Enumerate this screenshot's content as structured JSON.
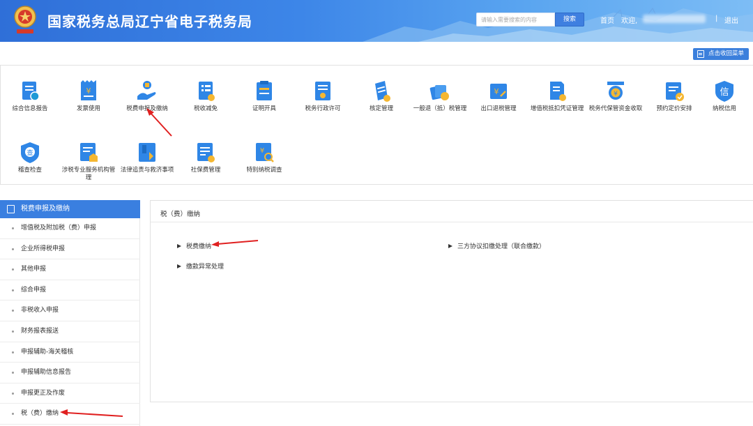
{
  "header": {
    "title": "国家税务总局辽宁省电子税务局",
    "search_placeholder": "请输入需要搜索的内容",
    "search_button": "搜索",
    "home": "首页",
    "welcome": "欢迎,",
    "separator": "|",
    "logout": "退出"
  },
  "collapse_button": "点击收回菜单",
  "menu": {
    "items": [
      {
        "label": "综合信息报告",
        "icon": "report-icon"
      },
      {
        "label": "发票使用",
        "icon": "invoice-icon"
      },
      {
        "label": "税费申报及缴纳",
        "icon": "tax-declare-icon"
      },
      {
        "label": "税收减免",
        "icon": "tax-relief-icon"
      },
      {
        "label": "证明开具",
        "icon": "certificate-icon"
      },
      {
        "label": "税务行政许可",
        "icon": "license-icon"
      },
      {
        "label": "核定管理",
        "icon": "verify-icon"
      },
      {
        "label": "一般退（抵）税管理",
        "icon": "refund-icon"
      },
      {
        "label": "出口退税管理",
        "icon": "export-refund-icon"
      },
      {
        "label": "增值税抵扣凭证管理",
        "icon": "vat-deduction-icon"
      },
      {
        "label": "税务代保管资金收取",
        "icon": "custody-fund-icon"
      },
      {
        "label": "预约定价安排",
        "icon": "pricing-icon"
      },
      {
        "label": "纳税信用",
        "icon": "credit-icon"
      },
      {
        "label": "稽查检查",
        "icon": "inspection-icon"
      },
      {
        "label": "涉税专业服务机构管理",
        "icon": "agency-icon"
      },
      {
        "label": "法律追责与救济事项",
        "icon": "legal-icon"
      },
      {
        "label": "社保费管理",
        "icon": "social-insurance-icon"
      },
      {
        "label": "特别纳税调查",
        "icon": "investigation-icon"
      }
    ]
  },
  "sidebar": {
    "title": "税费申报及缴纳",
    "items": [
      {
        "label": "增值税及附加税（费）申报"
      },
      {
        "label": "企业所得税申报"
      },
      {
        "label": "其他申报"
      },
      {
        "label": "综合申报"
      },
      {
        "label": "非税收入申报"
      },
      {
        "label": "财务报表报送"
      },
      {
        "label": "申报辅助-海关稽核"
      },
      {
        "label": "申报辅助信息报告"
      },
      {
        "label": "申报更正及作废"
      },
      {
        "label": "税（费）缴纳"
      }
    ]
  },
  "content": {
    "title": "税（费）缴纳",
    "entries": [
      {
        "label": "税费缴纳"
      },
      {
        "label": "三方协议扣缴处理（联合缴款）"
      },
      {
        "label": "缴款异常处理"
      }
    ]
  },
  "colors": {
    "primary": "#3a7fe0",
    "arrow": "#e02020",
    "icon_blue": "#2f86e6"
  }
}
